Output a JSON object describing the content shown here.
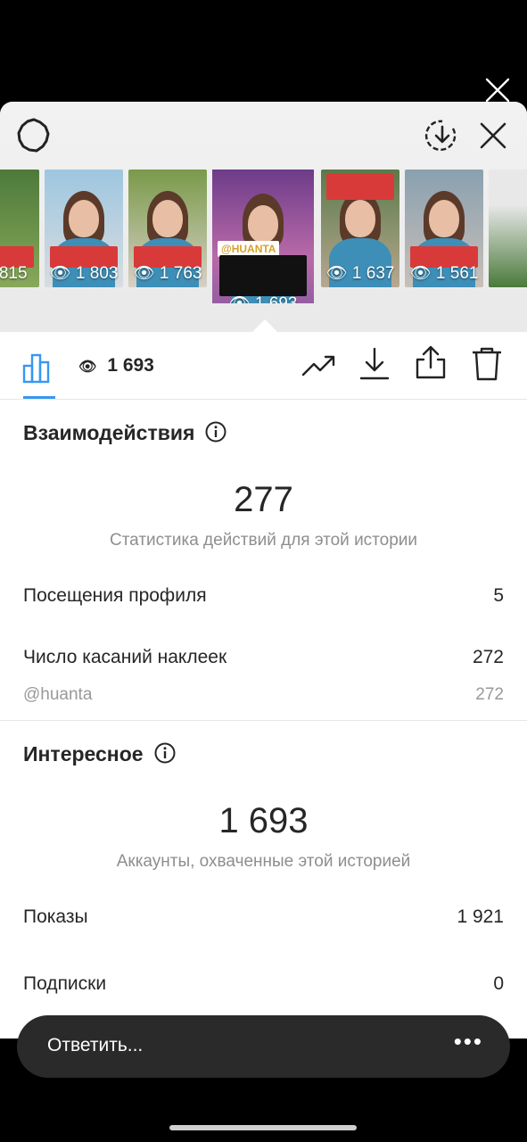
{
  "thumbnails": [
    {
      "views": "815"
    },
    {
      "views": "1 803"
    },
    {
      "views": "1 763"
    },
    {
      "views": "1 693",
      "tag": "@HUANTA",
      "active": true
    },
    {
      "views": "1 637"
    },
    {
      "views": "1 561"
    },
    {
      "views": ""
    }
  ],
  "toolbar": {
    "views": "1 693"
  },
  "interactions": {
    "title": "Взаимодействия",
    "total": "277",
    "caption": "Статистика действий для этой истории",
    "rows": [
      {
        "label": "Посещения профиля",
        "value": "5"
      },
      {
        "label": "Число касаний наклеек",
        "value": "272"
      }
    ],
    "sub_row": {
      "label": "@huanta",
      "value": "272"
    }
  },
  "discovery": {
    "title": "Интересное",
    "total": "1 693",
    "caption": "Аккаунты, охваченные этой историей",
    "rows": [
      {
        "label": "Показы",
        "value": "1 921"
      },
      {
        "label": "Подписки",
        "value": "0"
      }
    ]
  },
  "reply": {
    "placeholder": "Ответить...",
    "more": "•••"
  },
  "colors": {
    "accent": "#3897f0",
    "caption_red": "#d83a3a"
  },
  "icons": [
    "close-icon",
    "settings-icon",
    "download-circle-icon",
    "insights-icon",
    "eye-icon",
    "trend-icon",
    "download-icon",
    "share-icon",
    "trash-icon",
    "info-icon"
  ]
}
